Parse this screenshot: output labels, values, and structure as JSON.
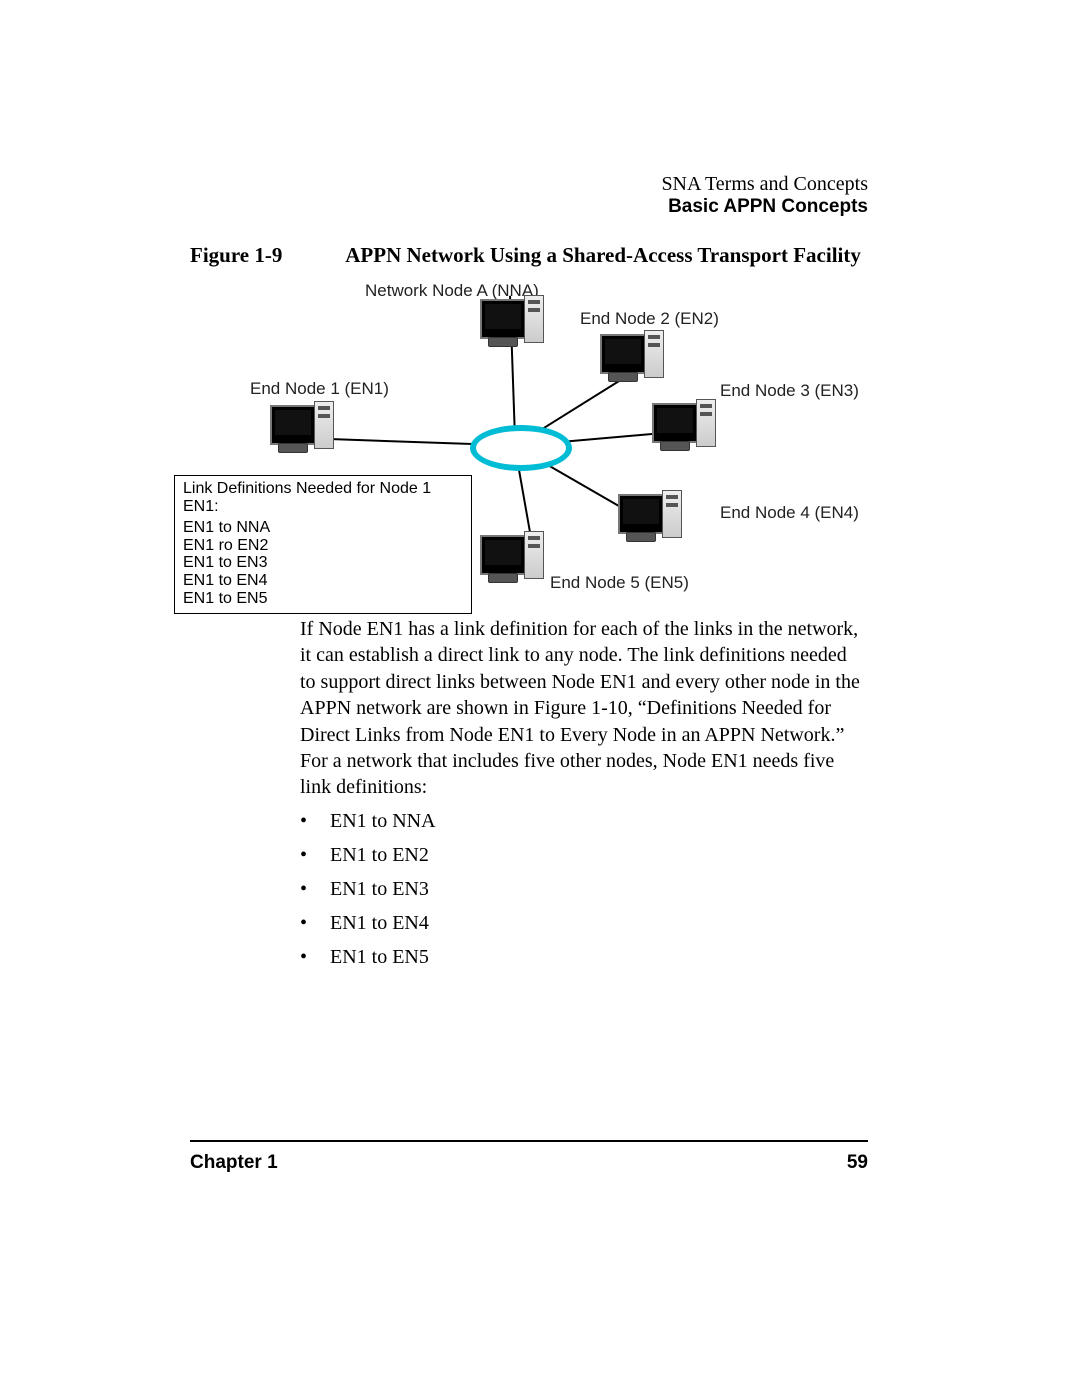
{
  "header": {
    "line1": "SNA Terms and Concepts",
    "line2": "Basic APPN Concepts"
  },
  "figure": {
    "label": "Figure 1-9",
    "title": "APPN Network Using a Shared-Access Transport Facility"
  },
  "diagram": {
    "nodes": {
      "nna": "Network Node A (NNA)",
      "en1": "End Node 1 (EN1)",
      "en2": "End Node 2 (EN2)",
      "en3": "End Node 3 (EN3)",
      "en4": "End Node 4 (EN4)",
      "en5": "End Node 5 (EN5)"
    },
    "linkbox": {
      "title": "Link Definitions Needed for Node 1 EN1:",
      "items": [
        "EN1 to NNA",
        "EN1 ro EN2",
        "EN1 to EN3",
        "EN1 to EN4",
        "EN1 to EN5"
      ]
    }
  },
  "body": {
    "paragraph": "If Node EN1 has a link definition for each of the links in the network, it can establish a direct link to any node. The link definitions needed to support direct links between Node EN1 and every other node in the APPN network are shown in Figure 1-10, “Definitions Needed for Direct Links from Node EN1 to Every Node in an APPN Network.” For a network that includes five other nodes, Node EN1 needs five link definitions:",
    "bullets": [
      "EN1 to NNA",
      "EN1 to EN2",
      "EN1 to EN3",
      "EN1 to EN4",
      "EN1 to EN5"
    ]
  },
  "footer": {
    "left": "Chapter 1",
    "right": "59"
  }
}
